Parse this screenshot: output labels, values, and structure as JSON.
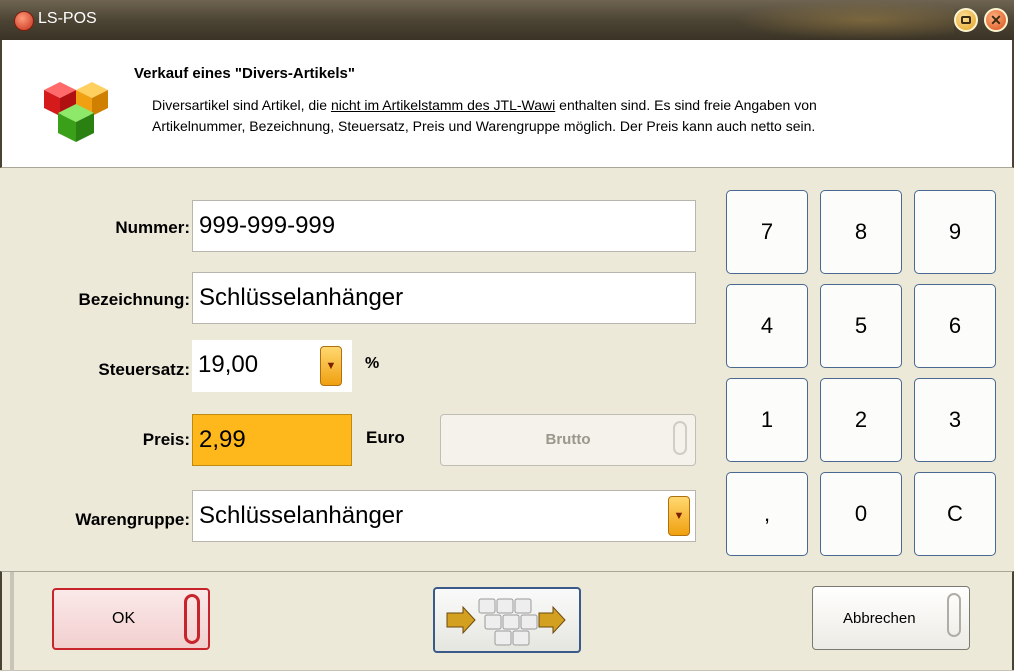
{
  "window": {
    "title": "LS-POS"
  },
  "header": {
    "title": "Verkauf eines \"Divers-Artikels\"",
    "desc_part1": "Diversartikel sind Artikel, die ",
    "desc_link": "nicht im Artikelstamm des JTL-Wawi",
    "desc_part2": " enthalten sind. Es sind freie Angaben von",
    "desc_line2": "Artikelnummer, Bezeichnung, Steuersatz, Preis und Warengruppe möglich. Der Preis kann auch netto sein."
  },
  "form": {
    "nummer_label": "Nummer:",
    "nummer_value": "999-999-999",
    "bezeichnung_label": "Bezeichnung:",
    "bezeichnung_value": "Schlüsselanhänger",
    "steuersatz_label": "Steuersatz:",
    "steuersatz_value": "19,00",
    "steuersatz_unit": "%",
    "preis_label": "Preis:",
    "preis_value": "2,99",
    "preis_unit": "Euro",
    "brutto_label": "Brutto",
    "warengruppe_label": "Warengruppe:",
    "warengruppe_value": "Schlüsselanhänger"
  },
  "keypad": {
    "keys": [
      "7",
      "8",
      "9",
      "4",
      "5",
      "6",
      "1",
      "2",
      "3",
      ",",
      "0",
      "C"
    ]
  },
  "footer": {
    "ok_label": "OK",
    "cancel_label": "Abbrechen"
  },
  "colors": {
    "preis_highlight": "#ffb81c",
    "ok_border": "#c8242c",
    "key_border": "#4a6890",
    "titlebar": "#4a4232"
  }
}
